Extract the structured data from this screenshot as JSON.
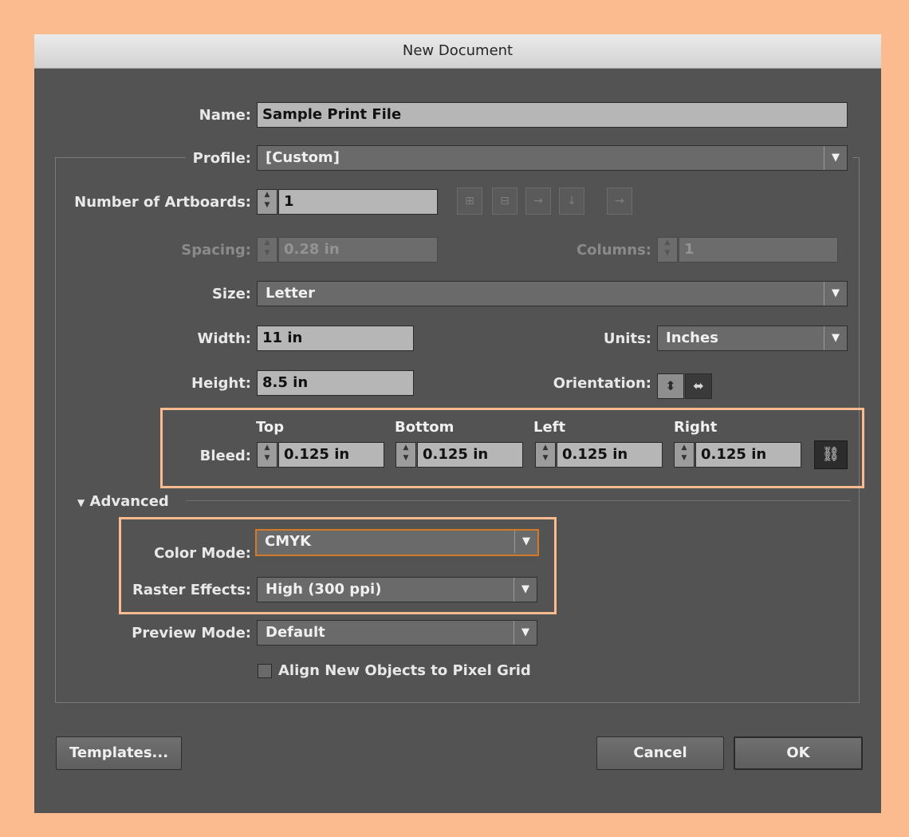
{
  "dialog": {
    "title": "New Document"
  },
  "name": {
    "label": "Name:",
    "value": "Sample Print File"
  },
  "profile": {
    "label": "Profile:",
    "value": "[Custom]"
  },
  "artboards": {
    "label": "Number of Artboards:",
    "value": "1",
    "layout_icons": [
      "grid-by-row-icon",
      "grid-by-column-icon",
      "arrange-by-row-icon",
      "arrange-by-column-icon",
      "right-to-left-icon"
    ]
  },
  "spacing": {
    "label": "Spacing:",
    "value": "0.28 in",
    "disabled": true
  },
  "columns": {
    "label": "Columns:",
    "value": "1",
    "disabled": true
  },
  "size": {
    "label": "Size:",
    "value": "Letter"
  },
  "width": {
    "label": "Width:",
    "value": "11 in"
  },
  "height": {
    "label": "Height:",
    "value": "8.5 in"
  },
  "units": {
    "label": "Units:",
    "value": "Inches"
  },
  "orientation": {
    "label": "Orientation:",
    "selected": "landscape"
  },
  "bleed": {
    "label": "Bleed:",
    "top": {
      "header": "Top",
      "value": "0.125 in"
    },
    "bottom": {
      "header": "Bottom",
      "value": "0.125 in"
    },
    "left": {
      "header": "Left",
      "value": "0.125 in"
    },
    "right": {
      "header": "Right",
      "value": "0.125 in"
    },
    "link_icon": "chain-link-icon"
  },
  "advanced": {
    "label": "Advanced"
  },
  "color_mode": {
    "label": "Color Mode:",
    "value": "CMYK"
  },
  "raster_effects": {
    "label": "Raster Effects:",
    "value": "High (300 ppi)"
  },
  "preview_mode": {
    "label": "Preview Mode:",
    "value": "Default"
  },
  "align_pixel_grid": {
    "label": "Align New Objects to Pixel Grid",
    "checked": false
  },
  "buttons": {
    "templates": "Templates...",
    "cancel": "Cancel",
    "ok": "OK"
  },
  "colors": {
    "dialog_bg": "#535353",
    "highlight": "#fbbb8f",
    "focus": "#d27a2a"
  }
}
